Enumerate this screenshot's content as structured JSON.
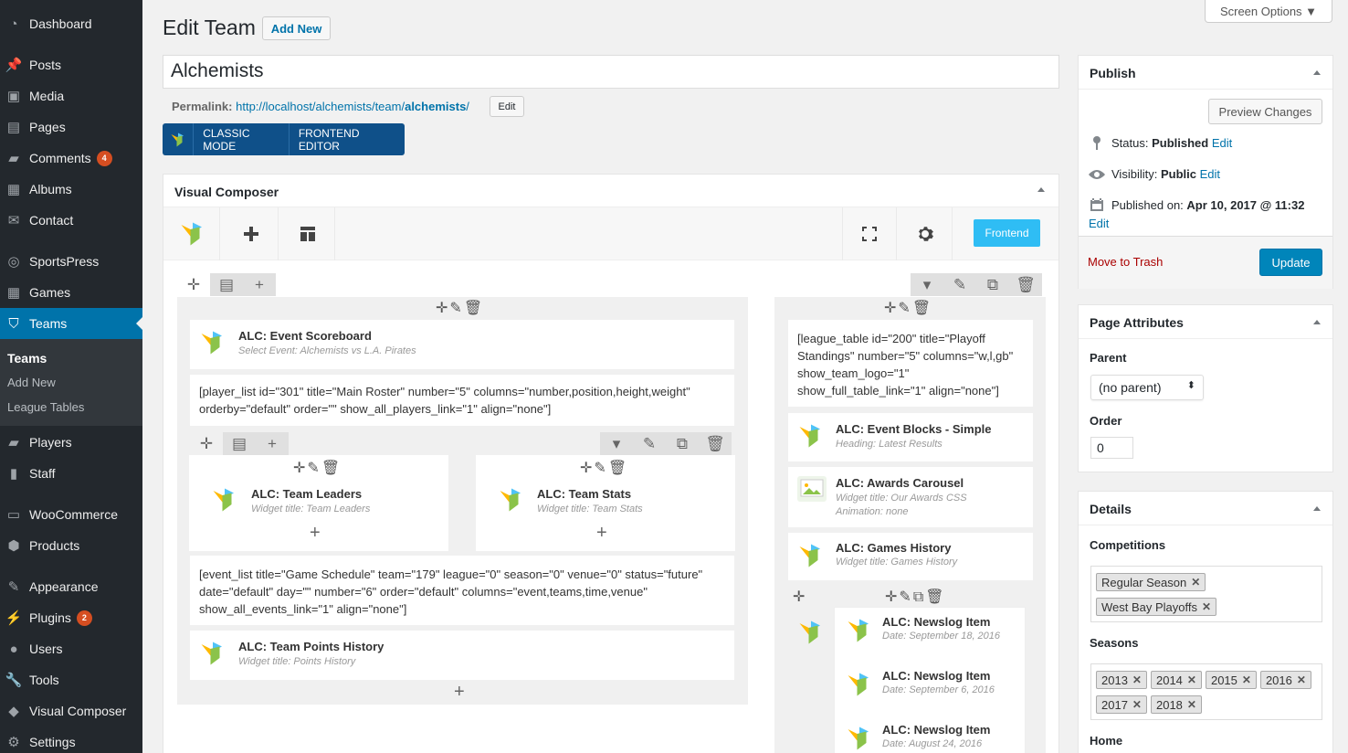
{
  "sidebar": {
    "items": [
      {
        "label": "Dashboard",
        "icon": "dashboard-icon"
      },
      {
        "label": "Posts",
        "icon": "pin-icon"
      },
      {
        "label": "Media",
        "icon": "media-icon"
      },
      {
        "label": "Pages",
        "icon": "pages-icon"
      },
      {
        "label": "Comments",
        "icon": "comment-icon",
        "badge": "4"
      },
      {
        "label": "Albums",
        "icon": "albums-icon"
      },
      {
        "label": "Contact",
        "icon": "mail-icon"
      },
      {
        "label": "SportsPress",
        "icon": "sportspress-icon"
      },
      {
        "label": "Games",
        "icon": "calendar-icon"
      },
      {
        "label": "Teams",
        "icon": "shield-icon"
      },
      {
        "label": "Players",
        "icon": "players-icon"
      },
      {
        "label": "Staff",
        "icon": "staff-icon"
      },
      {
        "label": "WooCommerce",
        "icon": "woo-icon"
      },
      {
        "label": "Products",
        "icon": "products-icon"
      },
      {
        "label": "Appearance",
        "icon": "brush-icon"
      },
      {
        "label": "Plugins",
        "icon": "plugin-icon",
        "badge": "2"
      },
      {
        "label": "Users",
        "icon": "user-icon"
      },
      {
        "label": "Tools",
        "icon": "wrench-icon"
      },
      {
        "label": "Visual Composer",
        "icon": "vc-icon"
      },
      {
        "label": "Settings",
        "icon": "settings-icon"
      }
    ],
    "submenu": [
      "Teams",
      "Add New",
      "League Tables"
    ]
  },
  "header": {
    "title": "Edit Team",
    "add_new": "Add New",
    "screen_options": "Screen Options ▼"
  },
  "post": {
    "title": "Alchemists",
    "permalink_label": "Permalink:",
    "permalink_base": "http://localhost/alchemists/team/",
    "permalink_slug": "alchemists",
    "permalink_end": "/",
    "edit": "Edit"
  },
  "vcbar": {
    "classic": "CLASSIC MODE",
    "frontend": "FRONTEND EDITOR"
  },
  "vc": {
    "title": "Visual Composer",
    "frontend_btn": "Frontend",
    "left": {
      "scoreboard": {
        "title": "ALC: Event Scoreboard",
        "sub": "Select Event: Alchemists vs L.A. Pirates"
      },
      "player_list": "[player_list id=\"301\" title=\"Main Roster\" number=\"5\" columns=\"number,position,height,weight\" orderby=\"default\" order=\"\" show_all_players_link=\"1\" align=\"none\"]",
      "leaders": {
        "title": "ALC: Team Leaders",
        "sub": "Widget title: Team Leaders"
      },
      "stats": {
        "title": "ALC: Team Stats",
        "sub": "Widget title: Team Stats"
      },
      "event_list": "[event_list title=\"Game Schedule\" team=\"179\" league=\"0\" season=\"0\" venue=\"0\" status=\"future\" date=\"default\" day=\"\" number=\"6\" order=\"default\" columns=\"event,teams,time,venue\" show_all_events_link=\"1\" align=\"none\"]",
      "points": {
        "title": "ALC: Team Points History",
        "sub": "Widget title: Points History"
      }
    },
    "right": {
      "league_table": "[league_table id=\"200\" title=\"Playoff Standings\" number=\"5\" columns=\"w,l,gb\" show_team_logo=\"1\" show_full_table_link=\"1\" align=\"none\"]",
      "event_blocks": {
        "title": "ALC: Event Blocks - Simple",
        "sub": "Heading: Latest Results"
      },
      "awards": {
        "title": "ALC: Awards Carousel",
        "sub": "Widget title: Our Awards  CSS",
        "sub2": "Animation: none"
      },
      "games": {
        "title": "ALC: Games History",
        "sub": "Widget title: Games History"
      },
      "news": [
        {
          "title": "ALC: Newslog Item",
          "sub": "Date: September 18, 2016"
        },
        {
          "title": "ALC: Newslog Item",
          "sub": "Date: September 6, 2016"
        },
        {
          "title": "ALC: Newslog Item",
          "sub": "Date: August 24, 2016"
        }
      ]
    }
  },
  "publish": {
    "title": "Publish",
    "preview": "Preview Changes",
    "status_label": "Status:",
    "status": "Published",
    "visibility_label": "Visibility:",
    "visibility": "Public",
    "published_label": "Published on:",
    "published": "Apr 10, 2017 @ 11:32",
    "edit": "Edit",
    "trash": "Move to Trash",
    "update": "Update"
  },
  "attributes": {
    "title": "Page Attributes",
    "parent_label": "Parent",
    "parent": "(no parent)",
    "order_label": "Order",
    "order": "0"
  },
  "details": {
    "title": "Details",
    "competitions_label": "Competitions",
    "competitions": [
      "Regular Season",
      "West Bay Playoffs"
    ],
    "seasons_label": "Seasons",
    "seasons": [
      "2013",
      "2014",
      "2015",
      "2016",
      "2017",
      "2018"
    ],
    "home_label": "Home"
  },
  "colors": {
    "admin_bar": "#23282d",
    "accent": "#0073aa",
    "vc_blue": "#0f5089",
    "frontend": "#2fbdf4",
    "badge": "#d54e21"
  }
}
